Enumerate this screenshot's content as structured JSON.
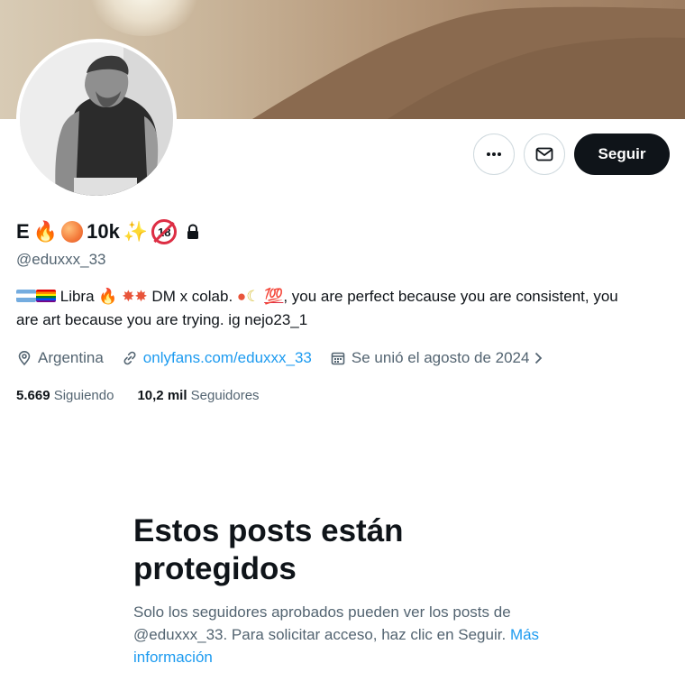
{
  "profile": {
    "display_name_initial": "E",
    "display_name_count": "10k",
    "adult_badge": "18",
    "handle": "@eduxxx_33",
    "bio": {
      "part1": "Libra",
      "part2": "DM x colab.",
      "emoji_hundred": "💯",
      "part3": ", you are perfect because you are consistent, you are art because you are trying. ig nejo23_1"
    },
    "location": "Argentina",
    "website": "onlyfans.com/eduxxx_33",
    "joined": "Se unió el agosto de 2024",
    "following_count": "5.669",
    "following_label": "Siguiendo",
    "followers_count": "10,2 mil",
    "followers_label": "Seguidores"
  },
  "actions": {
    "more_icon": "more-dots-icon",
    "message_icon": "envelope-icon",
    "follow_label": "Seguir"
  },
  "protected_notice": {
    "title": "Estos posts están protegidos",
    "body": "Solo los seguidores aprobados pueden ver los posts de @eduxxx_33. Para solicitar acceso, haz clic en Seguir.",
    "more_link": "Más información"
  },
  "colors": {
    "accent": "#1d9bf0",
    "text_primary": "#0f1419",
    "text_secondary": "#536471",
    "button_dark": "#0f1419"
  }
}
